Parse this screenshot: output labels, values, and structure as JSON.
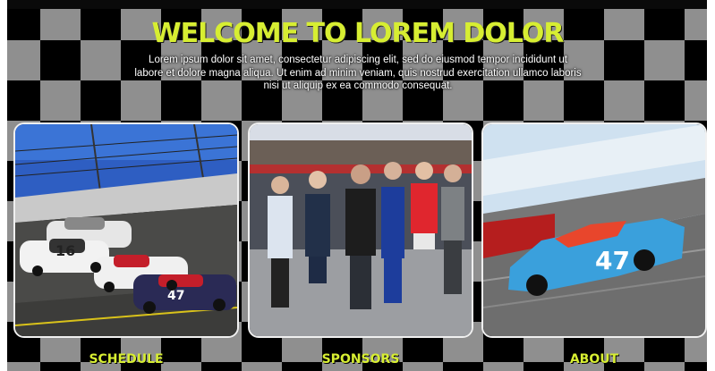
{
  "hero": {
    "title": "WELCOME TO LOREM DOLOR",
    "intro": "Lorem ipsum dolor sit amet, consectetur adipiscing elit, sed do eiusmod tempor incididunt ut labore et dolore magna aliqua. Ut enim ad minim veniam, quis nostrud exercitation ullamco laboris nisi ut aliquip ex ea commodo consequat."
  },
  "cards": [
    {
      "label": "SCHEDULE",
      "image": "race-cars-on-track-photo"
    },
    {
      "label": "SPONSORS",
      "image": "crew-group-photo"
    },
    {
      "label": "ABOUT",
      "image": "blue-race-car-47-photo"
    }
  ],
  "colors": {
    "accent": "#d7ee32",
    "checker_light": "#8f8f8f",
    "checker_dark": "#000000"
  }
}
